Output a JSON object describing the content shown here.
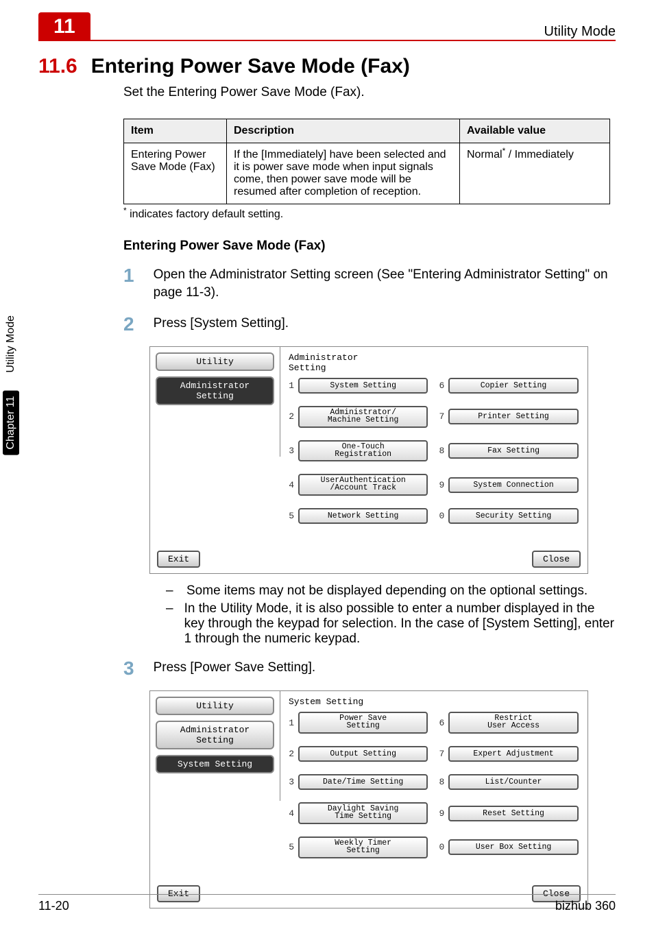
{
  "chapter_tab": "11",
  "header_right": "Utility Mode",
  "section_number": "11.6",
  "section_title": "Entering Power Save Mode (Fax)",
  "intro": "Set the Entering Power Save Mode (Fax).",
  "table": {
    "headers": [
      "Item",
      "Description",
      "Available value"
    ],
    "row": {
      "item": "Entering Power Save Mode (Fax)",
      "desc": "If the [Immediately] have been selected and it is power save mode when input signals come, then power save mode will be resumed after completion of reception.",
      "avail_pre": "Normal",
      "avail_post": " / Immediately"
    }
  },
  "footnote": " indicates factory default setting.",
  "subhead": "Entering Power Save Mode (Fax)",
  "steps": {
    "s1": "Open the Administrator Setting screen (See \"Entering Administrator Setting\" on page 11-3).",
    "s2": "Press [System Setting].",
    "s3": "Press [Power Save Setting]."
  },
  "bullets": {
    "b1": "Some items may not be displayed depending on the optional settings.",
    "b2": "In the Utility Mode, it is also possible to enter a number displayed in the key through the keypad for selection. In the case of [System Setting], enter 1 through the numeric keypad."
  },
  "panel1": {
    "title_top": "Administrator",
    "title_bottom": "Setting",
    "left_tab1": "Utility",
    "left_tab2_top": "Administrator",
    "left_tab2_bottom": "Setting",
    "exit": "Exit",
    "close": "Close",
    "items": [
      {
        "n": "1",
        "t": "System Setting"
      },
      {
        "n": "2",
        "t": "Administrator/\nMachine Setting"
      },
      {
        "n": "3",
        "t": "One-Touch\nRegistration"
      },
      {
        "n": "4",
        "t": "UserAuthentication\n/Account Track"
      },
      {
        "n": "5",
        "t": "Network Setting"
      },
      {
        "n": "6",
        "t": "Copier Setting"
      },
      {
        "n": "7",
        "t": "Printer Setting"
      },
      {
        "n": "8",
        "t": "Fax Setting"
      },
      {
        "n": "9",
        "t": "System Connection"
      },
      {
        "n": "0",
        "t": "Security Setting"
      }
    ]
  },
  "panel2": {
    "title": "System Setting",
    "left_tab1": "Utility",
    "left_tab2_top": "Administrator",
    "left_tab2_bottom": "Setting",
    "left_tab3": "System Setting",
    "exit": "Exit",
    "close": "Close",
    "items": [
      {
        "n": "1",
        "t": "Power Save\nSetting"
      },
      {
        "n": "2",
        "t": "Output Setting"
      },
      {
        "n": "3",
        "t": "Date/Time Setting"
      },
      {
        "n": "4",
        "t": "Daylight Saving\nTime Setting"
      },
      {
        "n": "5",
        "t": "Weekly Timer\nSetting"
      },
      {
        "n": "6",
        "t": "Restrict\nUser Access"
      },
      {
        "n": "7",
        "t": "Expert Adjustment"
      },
      {
        "n": "8",
        "t": "List/Counter"
      },
      {
        "n": "9",
        "t": "Reset Setting"
      },
      {
        "n": "0",
        "t": "User Box Setting"
      }
    ]
  },
  "side": {
    "top": "Chapter 11",
    "bottom": "Utility Mode"
  },
  "footer": {
    "left": "11-20",
    "right": "bizhub 360"
  }
}
